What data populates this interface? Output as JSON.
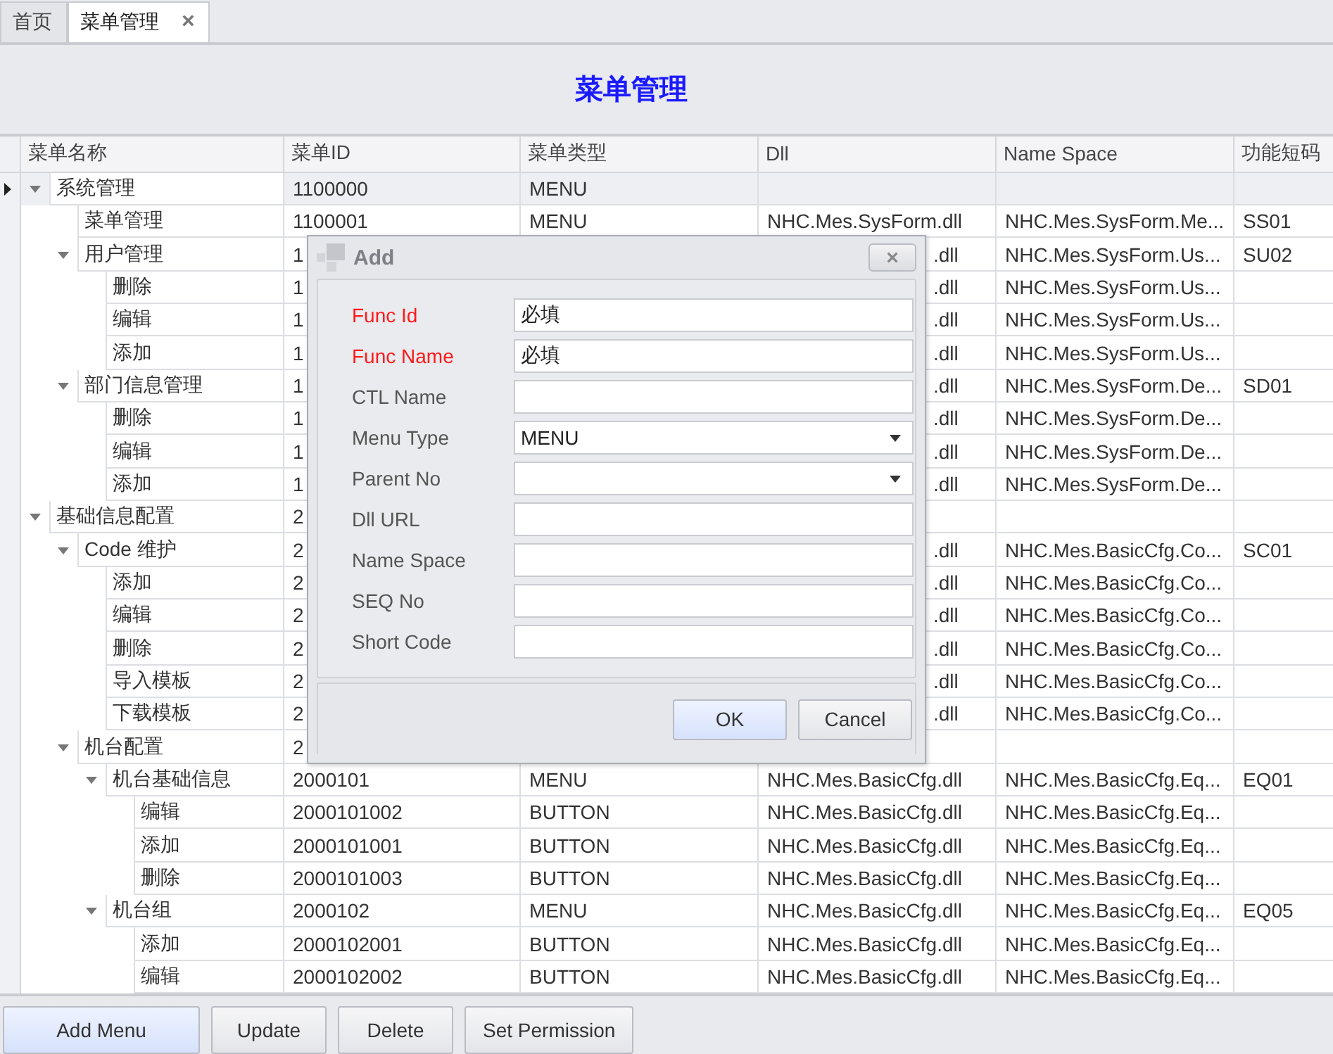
{
  "tabs": [
    {
      "label": "首页",
      "selected": false
    },
    {
      "label": "菜单管理",
      "selected": true,
      "close": "×"
    }
  ],
  "page_title": "菜单管理",
  "table": {
    "columns": [
      "菜单名称",
      "菜单ID",
      "菜单类型",
      "Dll",
      "Name Space",
      "功能短码"
    ],
    "rows": [
      {
        "name": "系统管理",
        "id": "1100000",
        "type": "MENU",
        "selected": true,
        "covered": false,
        "expanded": true,
        "children": [
          {
            "name": "菜单管理",
            "id": "1100001",
            "type": "MENU",
            "dll": "NHC.Mes.SysForm.dll",
            "namespace": "NHC.Mes.SysForm.Me...",
            "code": "SS01",
            "selected": false,
            "covered": false
          },
          {
            "name": "用户管理",
            "id": "1",
            "dll": ".dll",
            "namespace": "NHC.Mes.SysForm.Us...",
            "code": "SU02",
            "selected": false,
            "covered": true,
            "expanded": true,
            "children": [
              {
                "name": "删除",
                "id": "1",
                "dll": ".dll",
                "namespace": "NHC.Mes.SysForm.Us...",
                "selected": false,
                "covered": true
              },
              {
                "name": "编辑",
                "id": "1",
                "dll": ".dll",
                "namespace": "NHC.Mes.SysForm.Us...",
                "selected": false,
                "covered": true
              },
              {
                "name": "添加",
                "id": "1",
                "dll": ".dll",
                "namespace": "NHC.Mes.SysForm.Us...",
                "selected": false,
                "covered": true
              }
            ]
          },
          {
            "name": "部门信息管理",
            "id": "1",
            "dll": ".dll",
            "namespace": "NHC.Mes.SysForm.De...",
            "code": "SD01",
            "selected": false,
            "covered": true,
            "expanded": true,
            "children": [
              {
                "name": "删除",
                "id": "1",
                "dll": ".dll",
                "namespace": "NHC.Mes.SysForm.De...",
                "selected": false,
                "covered": true
              },
              {
                "name": "编辑",
                "id": "1",
                "dll": ".dll",
                "namespace": "NHC.Mes.SysForm.De...",
                "selected": false,
                "covered": true
              },
              {
                "name": "添加",
                "id": "1",
                "dll": ".dll",
                "namespace": "NHC.Mes.SysForm.De...",
                "selected": false,
                "covered": true
              }
            ]
          }
        ]
      },
      {
        "name": "基础信息配置",
        "id": "2",
        "selected": false,
        "covered": true,
        "expanded": true,
        "children": [
          {
            "name": "Code 维护",
            "id": "2",
            "dll": ".dll",
            "namespace": "NHC.Mes.BasicCfg.Co...",
            "code": "SC01",
            "selected": false,
            "covered": true,
            "expanded": true,
            "children": [
              {
                "name": "添加",
                "id": "2",
                "dll": ".dll",
                "namespace": "NHC.Mes.BasicCfg.Co...",
                "selected": false,
                "covered": true
              },
              {
                "name": "编辑",
                "id": "2",
                "dll": ".dll",
                "namespace": "NHC.Mes.BasicCfg.Co...",
                "selected": false,
                "covered": true
              },
              {
                "name": "删除",
                "id": "2",
                "dll": ".dll",
                "namespace": "NHC.Mes.BasicCfg.Co...",
                "selected": false,
                "covered": true
              },
              {
                "name": "导入模板",
                "id": "2",
                "dll": ".dll",
                "namespace": "NHC.Mes.BasicCfg.Co...",
                "selected": false,
                "covered": true
              },
              {
                "name": "下载模板",
                "id": "2",
                "dll": ".dll",
                "namespace": "NHC.Mes.BasicCfg.Co...",
                "selected": false,
                "covered": true
              }
            ]
          },
          {
            "name": "机台配置",
            "id": "2",
            "selected": false,
            "covered": true,
            "expanded": true,
            "children": [
              {
                "name": "机台基础信息",
                "id": "2000101",
                "type": "MENU",
                "dll": "NHC.Mes.BasicCfg.dll",
                "namespace": "NHC.Mes.BasicCfg.Eq...",
                "code": "EQ01",
                "selected": false,
                "covered": false,
                "expanded": true,
                "children": [
                  {
                    "name": "编辑",
                    "id": "2000101002",
                    "type": "BUTTON",
                    "dll": "NHC.Mes.BasicCfg.dll",
                    "namespace": "NHC.Mes.BasicCfg.Eq...",
                    "selected": false,
                    "covered": false
                  },
                  {
                    "name": "添加",
                    "id": "2000101001",
                    "type": "BUTTON",
                    "dll": "NHC.Mes.BasicCfg.dll",
                    "namespace": "NHC.Mes.BasicCfg.Eq...",
                    "selected": false,
                    "covered": false
                  },
                  {
                    "name": "删除",
                    "id": "2000101003",
                    "type": "BUTTON",
                    "dll": "NHC.Mes.BasicCfg.dll",
                    "namespace": "NHC.Mes.BasicCfg.Eq...",
                    "selected": false,
                    "covered": false
                  }
                ]
              },
              {
                "name": "机台组",
                "id": "2000102",
                "type": "MENU",
                "dll": "NHC.Mes.BasicCfg.dll",
                "namespace": "NHC.Mes.BasicCfg.Eq...",
                "code": "EQ05",
                "selected": false,
                "covered": false,
                "expanded": true,
                "children": [
                  {
                    "name": "添加",
                    "id": "2000102001",
                    "type": "BUTTON",
                    "dll": "NHC.Mes.BasicCfg.dll",
                    "namespace": "NHC.Mes.BasicCfg.Eq...",
                    "selected": false,
                    "covered": false
                  },
                  {
                    "name": "编辑",
                    "id": "2000102002",
                    "type": "BUTTON",
                    "dll": "NHC.Mes.BasicCfg.dll",
                    "namespace": "NHC.Mes.BasicCfg.Eq...",
                    "selected": false,
                    "covered": false
                  }
                ]
              }
            ]
          }
        ]
      }
    ]
  },
  "dialog": {
    "title": "Add",
    "close": "×",
    "fields": [
      {
        "label": "Func Id",
        "kind": "text",
        "value": "必填",
        "required": true
      },
      {
        "label": "Func Name",
        "kind": "text",
        "value": "必填",
        "required": true
      },
      {
        "label": "CTL Name",
        "kind": "text",
        "required": false
      },
      {
        "label": "Menu Type",
        "kind": "select",
        "value": "MENU",
        "required": false
      },
      {
        "label": "Parent No",
        "kind": "select",
        "required": false
      },
      {
        "label": "Dll URL",
        "kind": "text",
        "required": false
      },
      {
        "label": "Name Space",
        "kind": "text",
        "required": false
      },
      {
        "label": "SEQ No",
        "kind": "text",
        "required": false
      },
      {
        "label": "Short Code",
        "kind": "text",
        "required": false
      }
    ],
    "buttons": [
      {
        "label": "OK",
        "default": true
      },
      {
        "label": "Cancel",
        "default": false
      }
    ]
  },
  "buttons": [
    {
      "label": "Add Menu",
      "focused": true
    },
    {
      "label": "Update",
      "focused": false
    },
    {
      "label": "Delete",
      "focused": false
    },
    {
      "label": "Set Permission",
      "focused": false
    }
  ]
}
